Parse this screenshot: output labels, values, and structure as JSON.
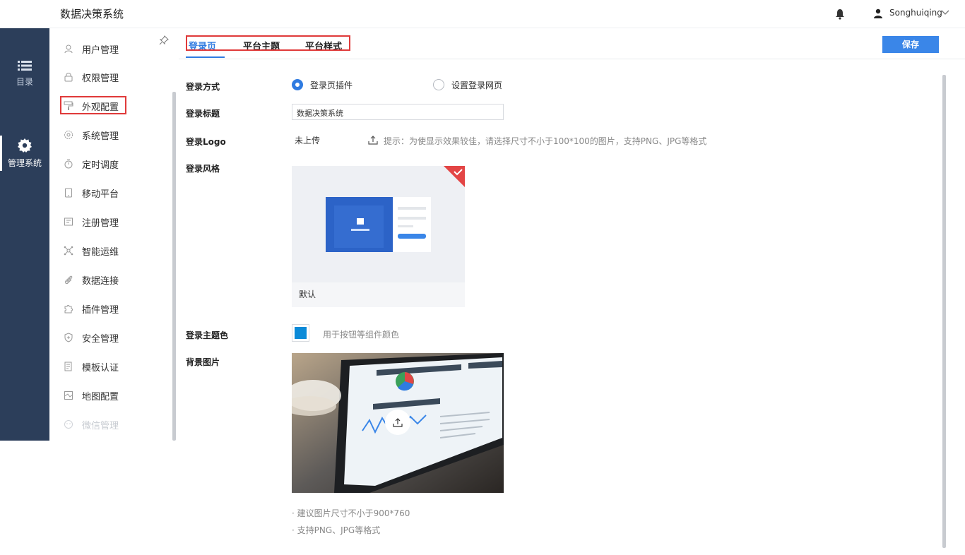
{
  "app": {
    "title": "数据决策系统"
  },
  "header": {
    "username": "Songhuiqing"
  },
  "darknav": {
    "items": [
      {
        "label": "目录",
        "icon": "list-icon"
      },
      {
        "label": "管理系统",
        "icon": "gear-icon",
        "active": true
      }
    ]
  },
  "subnav": {
    "items": [
      {
        "label": "用户管理",
        "icon": "user-manage-icon"
      },
      {
        "label": "权限管理",
        "icon": "lock-icon"
      },
      {
        "label": "外观配置",
        "icon": "paint-roller-icon",
        "selected": true
      },
      {
        "label": "系统管理",
        "icon": "gear-outline-icon"
      },
      {
        "label": "定时调度",
        "icon": "timer-icon"
      },
      {
        "label": "移动平台",
        "icon": "tablet-icon"
      },
      {
        "label": "注册管理",
        "icon": "register-icon"
      },
      {
        "label": "智能运维",
        "icon": "network-icon"
      },
      {
        "label": "数据连接",
        "icon": "paperclip-icon"
      },
      {
        "label": "插件管理",
        "icon": "puzzle-icon"
      },
      {
        "label": "安全管理",
        "icon": "shield-icon"
      },
      {
        "label": "模板认证",
        "icon": "template-icon"
      },
      {
        "label": "地图配置",
        "icon": "map-icon"
      },
      {
        "label": "微信管理",
        "icon": "wechat-icon"
      }
    ]
  },
  "tabs": [
    {
      "label": "登录页",
      "active": true
    },
    {
      "label": "平台主题"
    },
    {
      "label": "平台样式"
    }
  ],
  "toolbar": {
    "save_label": "保存"
  },
  "form": {
    "login_method": {
      "label": "登录方式",
      "options": [
        {
          "label": "登录页插件",
          "selected": true
        },
        {
          "label": "设置登录网页",
          "selected": false
        }
      ]
    },
    "login_title": {
      "label": "登录标题",
      "value": "数据决策系统"
    },
    "login_logo": {
      "label": "登录Logo",
      "status": "未上传",
      "hint": "提示：为使显示效果较佳，请选择尺寸不小于100*100的图片，支持PNG、JPG等格式"
    },
    "login_style": {
      "label": "登录风格",
      "card_label": "默认"
    },
    "theme_color": {
      "label": "登录主题色",
      "hint": "用于按钮等组件颜色",
      "color": "#0a8ad8"
    },
    "bg_image": {
      "label": "背景图片",
      "notes": [
        "· 建议图片尺寸不小于900*760",
        "· 支持PNG、JPG等格式"
      ]
    }
  },
  "colors": {
    "accent": "#2f7be1",
    "nav_dark": "#2c3e5a",
    "highlight": "#e03a3a"
  }
}
